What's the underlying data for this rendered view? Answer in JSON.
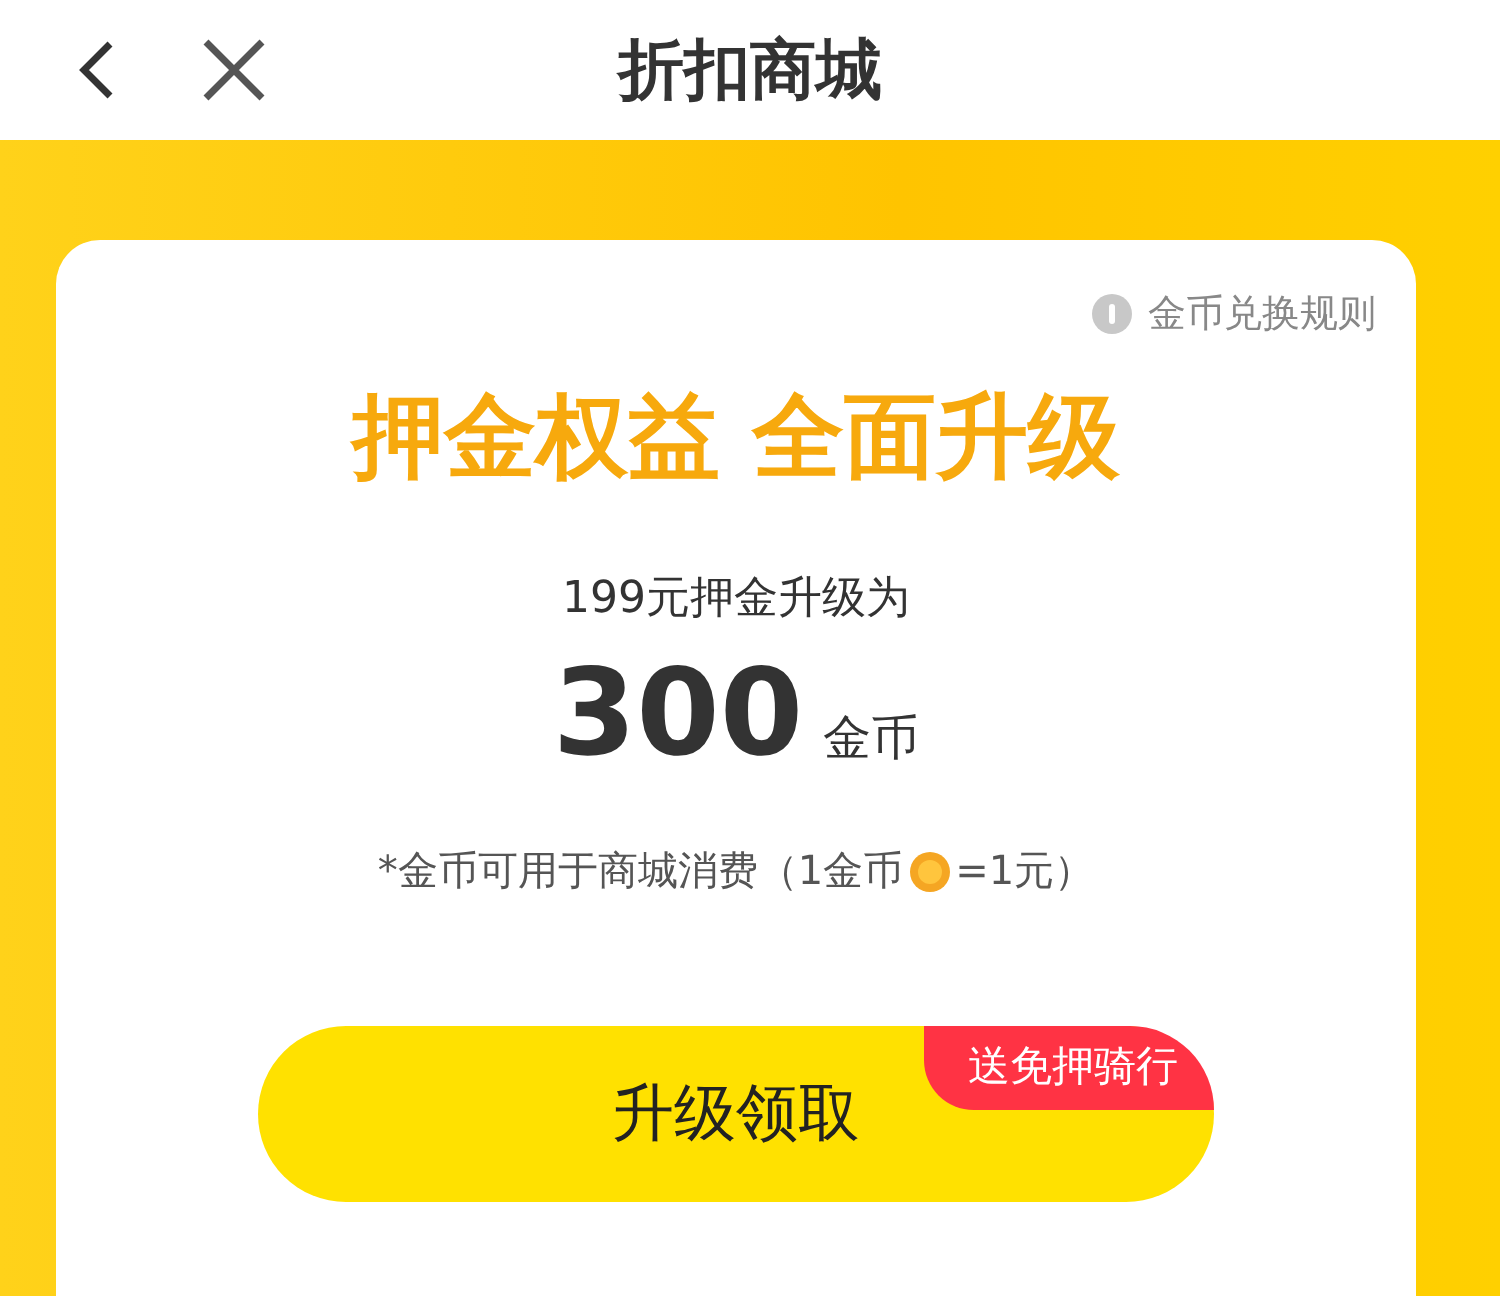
{
  "header": {
    "title": "折扣商城"
  },
  "card": {
    "rules_link": "金币兑换规则",
    "headline": "押金权益 全面升级",
    "subtitle": "199元押金升级为",
    "amount": "300",
    "unit": "金币",
    "note_before": "*金币可用于商城消费（1金币",
    "note_after": "=1元）",
    "button": {
      "label": "升级领取",
      "badge": "送免押骑行"
    }
  }
}
